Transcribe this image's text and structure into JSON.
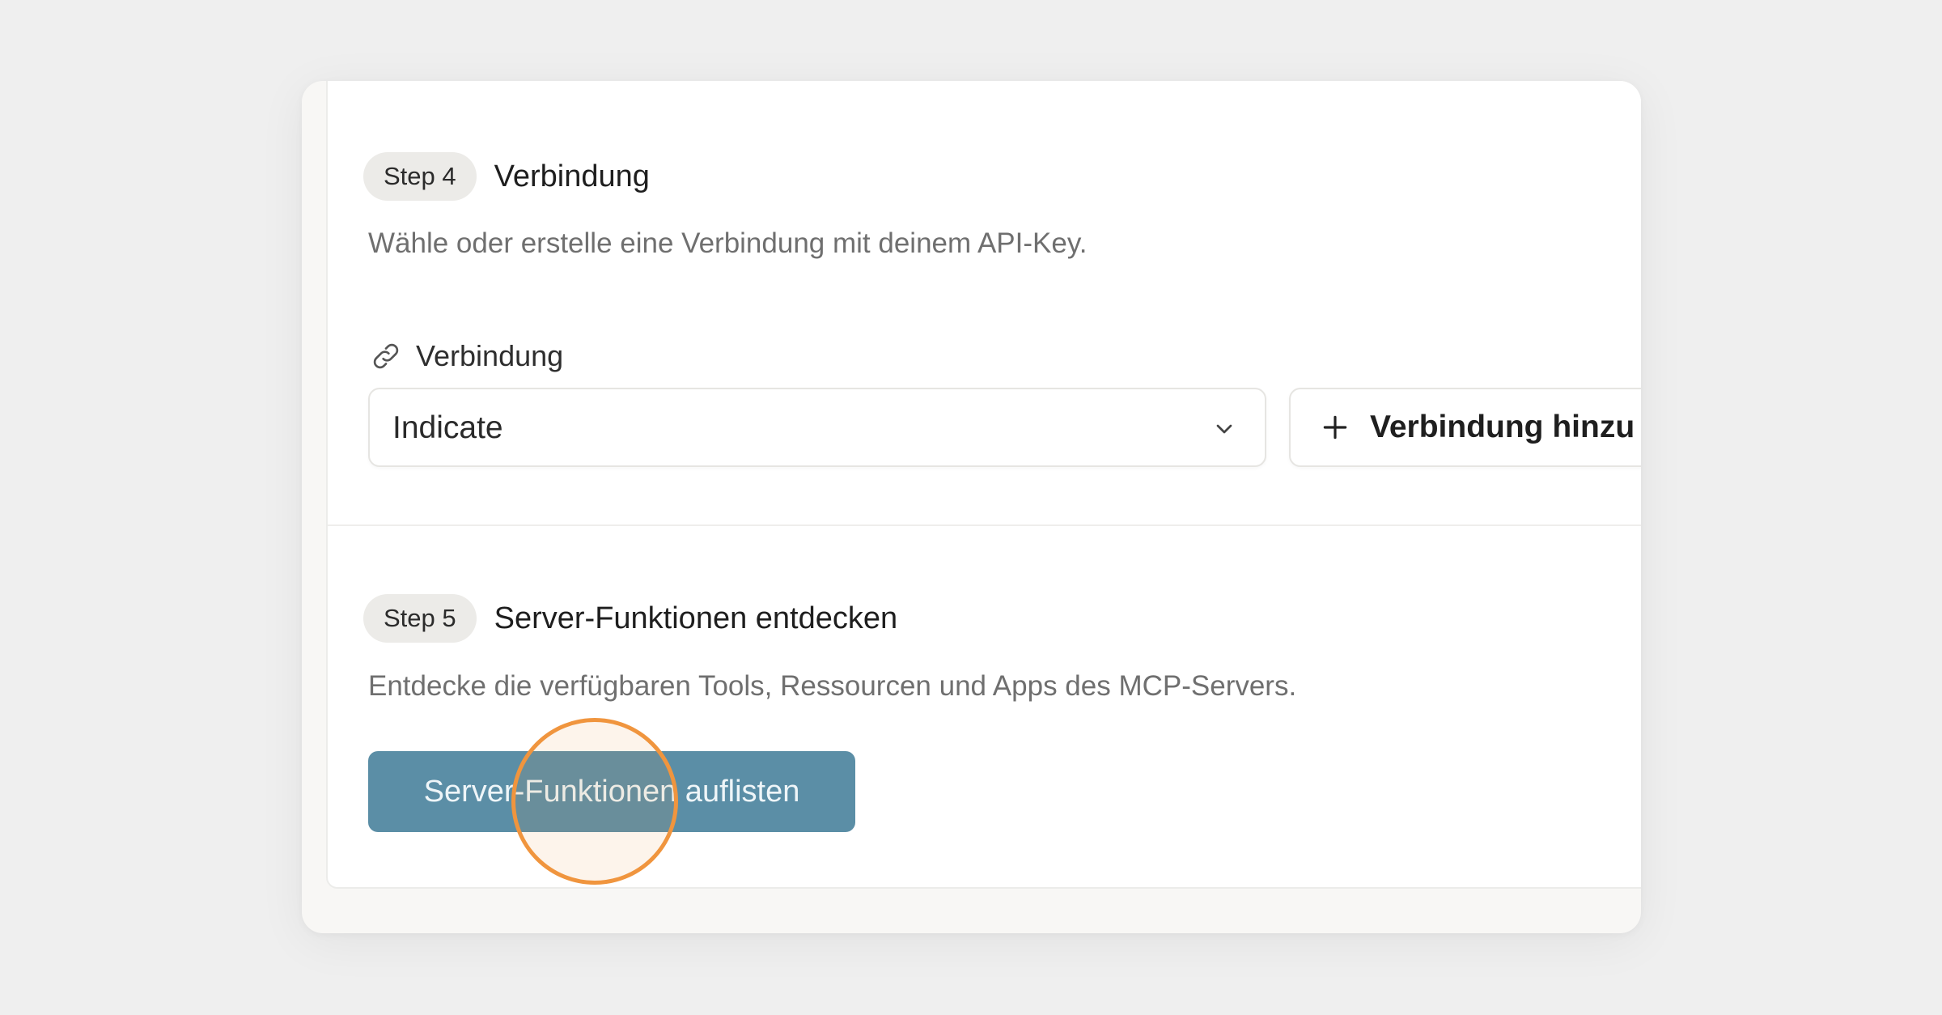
{
  "step4": {
    "badge": "Step 4",
    "title": "Verbindung",
    "description": "Wähle oder erstelle eine Verbindung mit deinem API-Key.",
    "field_label": "Verbindung",
    "field_icon": "link-icon",
    "select_value": "Indicate",
    "select_icon": "chevron-down-icon",
    "add_button_label": "Verbindung hinzu",
    "add_button_icon": "plus-icon"
  },
  "step5": {
    "badge": "Step 5",
    "title": "Server-Funktionen entdecken",
    "description": "Entdecke die verfügbaren Tools, Ressourcen und Apps des MCP-Servers.",
    "button_label": "Server-Funktionen auflisten"
  },
  "colors": {
    "primary_button": "#5b8ea6",
    "click_indicator": "#f0953e",
    "badge_bg": "#ecebe8"
  }
}
